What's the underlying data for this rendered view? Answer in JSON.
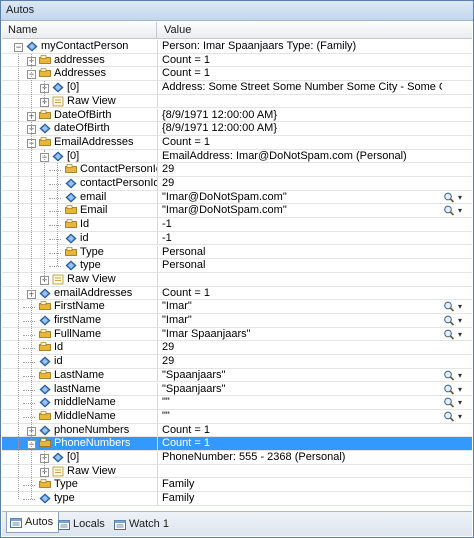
{
  "window": {
    "title": "Autos"
  },
  "columns": {
    "name": "Name",
    "value": "Value"
  },
  "rows": [
    {
      "depth": 0,
      "exp": "minus",
      "icon": "object",
      "name": "myContactPerson",
      "value": "Person: Imar Spaanjaars Type: (Family)",
      "viz": false
    },
    {
      "depth": 1,
      "exp": "plus",
      "icon": "property",
      "name": "addresses",
      "value": "Count = 1",
      "viz": false
    },
    {
      "depth": 1,
      "exp": "minus",
      "icon": "property",
      "name": "Addresses",
      "value": "Count = 1",
      "viz": false
    },
    {
      "depth": 2,
      "exp": "plus",
      "icon": "object",
      "name": "[0]",
      "value": "Address: Some Street Some Number Some City - Some Country (NotSet)",
      "viz": false
    },
    {
      "depth": 2,
      "exp": "plus",
      "icon": "rawview",
      "name": "Raw View",
      "value": "",
      "viz": false
    },
    {
      "depth": 1,
      "exp": "plus",
      "icon": "property",
      "name": "DateOfBirth",
      "value": "{8/9/1971 12:00:00 AM}",
      "viz": false
    },
    {
      "depth": 1,
      "exp": "plus",
      "icon": "object",
      "name": "dateOfBirth",
      "value": "{8/9/1971 12:00:00 AM}",
      "viz": false
    },
    {
      "depth": 1,
      "exp": "minus",
      "icon": "property",
      "name": "EmailAddresses",
      "value": "Count = 1",
      "viz": false
    },
    {
      "depth": 2,
      "exp": "minus",
      "icon": "object",
      "name": "[0]",
      "value": "EmailAddress: Imar@DoNotSpam.com (Personal)",
      "viz": false
    },
    {
      "depth": 3,
      "exp": "",
      "icon": "property",
      "name": "ContactPersonId",
      "value": "29",
      "viz": false
    },
    {
      "depth": 3,
      "exp": "",
      "icon": "object",
      "name": "contactPersonId",
      "value": "29",
      "viz": false
    },
    {
      "depth": 3,
      "exp": "",
      "icon": "object",
      "name": "email",
      "value": "\"Imar@DoNotSpam.com\"",
      "viz": true
    },
    {
      "depth": 3,
      "exp": "",
      "icon": "property",
      "name": "Email",
      "value": "\"Imar@DoNotSpam.com\"",
      "viz": true
    },
    {
      "depth": 3,
      "exp": "",
      "icon": "property",
      "name": "Id",
      "value": "-1",
      "viz": false
    },
    {
      "depth": 3,
      "exp": "",
      "icon": "object",
      "name": "id",
      "value": "-1",
      "viz": false
    },
    {
      "depth": 3,
      "exp": "",
      "icon": "property",
      "name": "Type",
      "value": "Personal",
      "viz": false
    },
    {
      "depth": 3,
      "exp": "",
      "icon": "object",
      "name": "type",
      "value": "Personal",
      "viz": false
    },
    {
      "depth": 2,
      "exp": "plus",
      "icon": "rawview",
      "name": "Raw View",
      "value": "",
      "viz": false
    },
    {
      "depth": 1,
      "exp": "plus",
      "icon": "object",
      "name": "emailAddresses",
      "value": "Count = 1",
      "viz": false
    },
    {
      "depth": 1,
      "exp": "",
      "icon": "property",
      "name": "FirstName",
      "value": "\"Imar\"",
      "viz": true
    },
    {
      "depth": 1,
      "exp": "",
      "icon": "object",
      "name": "firstName",
      "value": "\"Imar\"",
      "viz": true
    },
    {
      "depth": 1,
      "exp": "",
      "icon": "property",
      "name": "FullName",
      "value": "\"Imar Spaanjaars\"",
      "viz": true
    },
    {
      "depth": 1,
      "exp": "",
      "icon": "property",
      "name": "Id",
      "value": "29",
      "viz": false
    },
    {
      "depth": 1,
      "exp": "",
      "icon": "object",
      "name": "id",
      "value": "29",
      "viz": false
    },
    {
      "depth": 1,
      "exp": "",
      "icon": "property",
      "name": "LastName",
      "value": "\"Spaanjaars\"",
      "viz": true
    },
    {
      "depth": 1,
      "exp": "",
      "icon": "object",
      "name": "lastName",
      "value": "\"Spaanjaars\"",
      "viz": true
    },
    {
      "depth": 1,
      "exp": "",
      "icon": "object",
      "name": "middleName",
      "value": "\"\"",
      "viz": true
    },
    {
      "depth": 1,
      "exp": "",
      "icon": "property",
      "name": "MiddleName",
      "value": "\"\"",
      "viz": true
    },
    {
      "depth": 1,
      "exp": "plus",
      "icon": "object",
      "name": "phoneNumbers",
      "value": "Count = 1",
      "viz": false
    },
    {
      "depth": 1,
      "exp": "minus",
      "icon": "property",
      "name": "PhoneNumbers",
      "value": "Count = 1",
      "viz": false,
      "selected": true
    },
    {
      "depth": 2,
      "exp": "plus",
      "icon": "object",
      "name": "[0]",
      "value": "PhoneNumber: 555 - 2368 (Personal)",
      "viz": false
    },
    {
      "depth": 2,
      "exp": "plus",
      "icon": "rawview",
      "name": "Raw View",
      "value": "",
      "viz": false
    },
    {
      "depth": 1,
      "exp": "",
      "icon": "property",
      "name": "Type",
      "value": "Family",
      "viz": false
    },
    {
      "depth": 1,
      "exp": "",
      "icon": "object",
      "name": "type",
      "value": "Family",
      "viz": false
    }
  ],
  "tabs": [
    {
      "label": "Autos",
      "active": true
    },
    {
      "label": "Locals",
      "active": false
    },
    {
      "label": "Watch 1",
      "active": false
    }
  ],
  "colors": {
    "selection": "#3399ff",
    "property_icon": "#e8b73a",
    "object_icon": "#3d7cc9"
  }
}
